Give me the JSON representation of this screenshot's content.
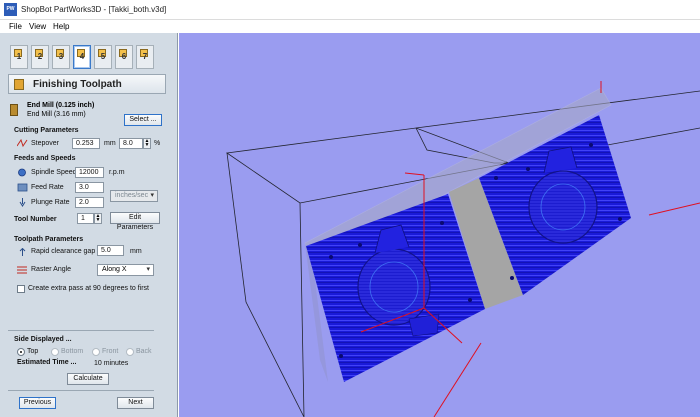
{
  "window": {
    "app_icon_text": "PW",
    "title": "ShopBot PartWorks3D - [Takki_both.v3d]"
  },
  "menu": [
    {
      "label": "File"
    },
    {
      "label": "View"
    },
    {
      "label": "Help"
    }
  ],
  "tool_tabs": [
    {
      "number": "1",
      "icon": "rough-toolpath-icon"
    },
    {
      "number": "2",
      "icon": "finish-toolpath-icon"
    },
    {
      "number": "3",
      "icon": "cutout-icon"
    },
    {
      "number": "4",
      "icon": "finishing-toolpath-icon",
      "active": true
    },
    {
      "number": "5",
      "icon": "preview-icon"
    },
    {
      "number": "6",
      "icon": "search-icon"
    },
    {
      "number": "7",
      "icon": "save-toolpath-icon"
    }
  ],
  "panel": {
    "title": "Finishing Toolpath",
    "tool_name": "End Mill (0.125 inch)",
    "tool_subname": "End Mill (3.16 mm)",
    "select_button": "Select ...",
    "cutting_section": "Cutting Parameters",
    "stepover_label": "Stepover",
    "stepover_value": "0.253",
    "stepover_unit": "mm",
    "stepover_percent": "8.0",
    "percent_sign": "%",
    "feeds_section": "Feeds and Speeds",
    "spindle_label": "Spindle Speed",
    "spindle_value": "12000",
    "spindle_unit": "r.p.m",
    "feed_label": "Feed Rate",
    "feed_value": "3.0",
    "plunge_label": "Plunge Rate",
    "plunge_value": "2.0",
    "rate_units": "inches/sec",
    "tool_number_label": "Tool Number",
    "tool_number_value": "1",
    "edit_params_button": "Edit Parameters",
    "toolpath_section": "Toolpath Parameters",
    "clearance_label": "Rapid clearance gap",
    "clearance_value": "5.0",
    "clearance_unit": "mm",
    "raster_label": "Raster Angle",
    "raster_value": "Along X",
    "extra_pass_label": "Create extra pass at 90 degrees to first",
    "side_section": "Side Displayed ...",
    "sides": [
      {
        "label": "Top",
        "checked": true,
        "enabled": true
      },
      {
        "label": "Bottom",
        "checked": false,
        "enabled": false
      },
      {
        "label": "Front",
        "checked": false,
        "enabled": false
      },
      {
        "label": "Back",
        "checked": false,
        "enabled": false
      }
    ],
    "estimated_label": "Estimated Time ...",
    "estimated_value": "10 minutes",
    "calculate_button": "Calculate",
    "previous_button": "Previous",
    "next_button": "Next"
  },
  "viewport": {
    "background_color": "#9a9cf0",
    "model_color": "#1a1ad8",
    "box_color": "#8fa0b8",
    "axis_color": "#e01020"
  }
}
